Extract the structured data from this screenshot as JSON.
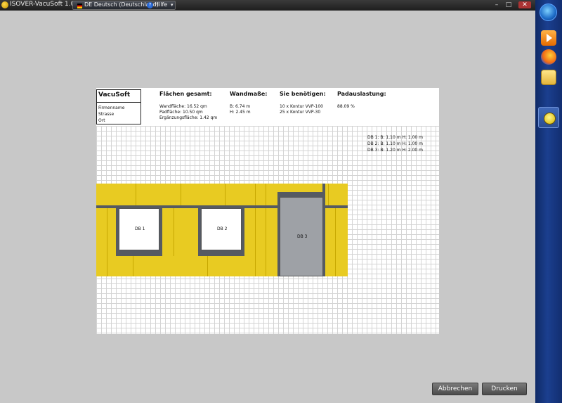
{
  "window": {
    "title": "ISOVER-VacuSoft 1.0",
    "minimize_glyph": "–",
    "maximize_glyph": "□",
    "close_glyph": "✕"
  },
  "toolbar": {
    "language": "DE Deutsch (Deutschland)",
    "help_label": "Hilfe",
    "help_icon_glyph": "?",
    "help_arrow_glyph": "▾"
  },
  "sheet": {
    "brand": "VacuSoft",
    "address": {
      "name": "Firmenname",
      "street": "Strasse",
      "city": "Ort"
    },
    "flaechen": {
      "heading": "Flächen gesamt:",
      "wand": "Wandfläche: 16.52 qm",
      "pad": "Padfläche: 10.50 qm",
      "ergaenzung": "Ergänzungsfläche: 1.42 qm"
    },
    "wandmasse": {
      "heading": "Wandmaße:",
      "b": "B: 6.74 m",
      "h": "H: 2.45 m"
    },
    "benoetigen": {
      "heading": "Sie benötigen:",
      "line1": "10 x Kontur VVP-100",
      "line2": "25 x Kontur VVP-30"
    },
    "padauslastung": {
      "heading": "Padauslastung:",
      "value": "88.09 %"
    },
    "db_info": {
      "db1": "DB 1: B: 1.10 m H: 1.00 m",
      "db2": "DB 2: B: 1.10 m H: 1.00 m",
      "db3": "DB 3: B: 1.20 m H: 2.00 m"
    },
    "wall_labels": {
      "db1": "DB 1",
      "db2": "DB 2",
      "db3": "DB 3"
    }
  },
  "buttons": {
    "cancel": "Abbrechen",
    "print": "Drucken"
  },
  "colors": {
    "pad_yellow": "#e8cb22",
    "window_frame": "#555a62",
    "door_gray": "#9ea1a6"
  }
}
